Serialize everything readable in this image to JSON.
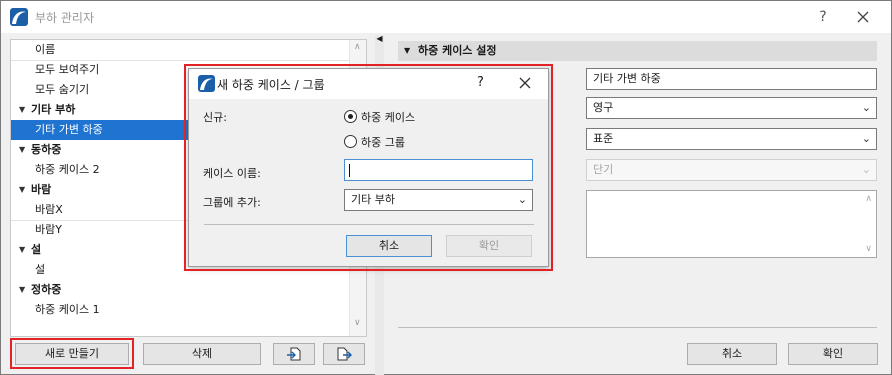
{
  "window": {
    "title": "부하 관리자",
    "help_label": "?",
    "close_label": "✕"
  },
  "tree": {
    "rows": [
      {
        "label": "이름",
        "type": "item"
      },
      {
        "label": "모두 보여주기",
        "type": "item"
      },
      {
        "label": "모두 숨기기",
        "type": "item"
      },
      {
        "label": "기타 부하",
        "type": "group"
      },
      {
        "label": "기타 가변 하중",
        "type": "item",
        "selected": true
      },
      {
        "label": "동하중",
        "type": "group"
      },
      {
        "label": "하중 케이스 2",
        "type": "item"
      },
      {
        "label": "바람",
        "type": "group"
      },
      {
        "label": "바람X",
        "type": "item"
      },
      {
        "label": "바람Y",
        "type": "item"
      },
      {
        "label": "설",
        "type": "group"
      },
      {
        "label": "설",
        "type": "item"
      },
      {
        "label": "정하중",
        "type": "group"
      },
      {
        "label": "하중 케이스 1",
        "type": "item"
      }
    ]
  },
  "bottom_left": {
    "new_label": "새로 만들기",
    "delete_label": "삭제"
  },
  "right_panel": {
    "section_title": "하중 케이스 설정",
    "name_value": "기타 가변 하중",
    "duration_value": "영구",
    "class_value": "표준",
    "term_value": "단기",
    "cancel_label": "취소",
    "ok_label": "확인"
  },
  "dialog": {
    "title": "새 하중 케이스 / 그룹",
    "help_label": "?",
    "close_label": "✕",
    "new_label": "신규:",
    "option_case": "하중 케이스",
    "option_group": "하중 그룹",
    "case_name_label": "케이스 이름:",
    "case_name_value": "",
    "add_to_group_label": "그룹에 추가:",
    "add_to_group_value": "기타 부하",
    "cancel_label": "취소",
    "ok_label": "확인"
  },
  "colors": {
    "selection": "#1f74d2",
    "highlight": "#e32228",
    "brand": "#1b5fa8"
  }
}
